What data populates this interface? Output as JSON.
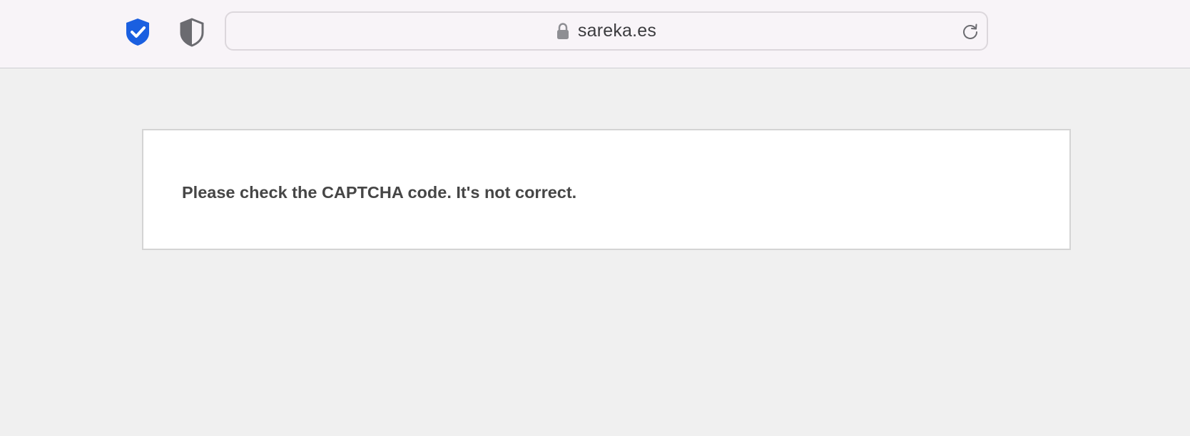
{
  "toolbar": {
    "url": "sareka.es",
    "icons": {
      "security_shield": "shield-check-icon",
      "privacy_shield": "shield-half-icon",
      "lock": "lock-icon",
      "reload": "reload-icon"
    },
    "colors": {
      "shield_blue": "#1a5fe0",
      "privacy_gray": "#6b6b70"
    }
  },
  "main": {
    "message": "Please check the CAPTCHA code. It's not correct."
  }
}
